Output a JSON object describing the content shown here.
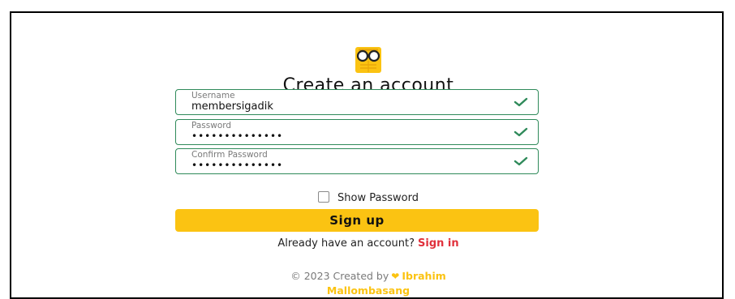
{
  "form": {
    "title": "Create an account",
    "username": {
      "label": "Username",
      "value": "membersigadik"
    },
    "password": {
      "label": "Password",
      "value": "••••••••••••••"
    },
    "confirm_password": {
      "label": "Confirm Password",
      "value": "••••••••••••••"
    },
    "show_password_label": "Show Password",
    "show_password_checked": false,
    "signup_label": "Sign up",
    "signin_prompt": "Already have an account?",
    "signin_link": "Sign in"
  },
  "footer": {
    "copyright": "© 2023 Created by",
    "author_first": "Ibrahim",
    "author_last": "Mallombasang"
  },
  "icons": {
    "logo": "owl-glasses-logo-icon",
    "field_valid": "check-icon",
    "footer_heart": "heart-icon"
  },
  "colors": {
    "accent": "#fbc312",
    "valid": "#2f8a5a",
    "link": "#e0313c"
  }
}
